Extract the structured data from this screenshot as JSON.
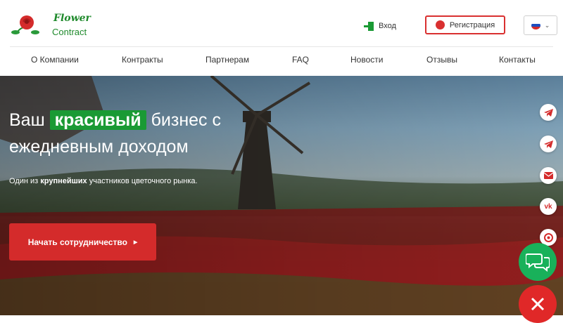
{
  "brand": {
    "line1": "Flower",
    "line2": "Contract"
  },
  "header": {
    "login_label": "Вход",
    "register_label": "Регистрация",
    "language": "RU"
  },
  "nav": {
    "items": [
      {
        "label": "О Компании"
      },
      {
        "label": "Контракты"
      },
      {
        "label": "Партнерам"
      },
      {
        "label": "FAQ"
      },
      {
        "label": "Новости"
      },
      {
        "label": "Отзывы"
      },
      {
        "label": "Контакты"
      }
    ]
  },
  "hero": {
    "title_part1": "Ваш",
    "title_highlight": "красивый",
    "title_part2": "бизнес с",
    "title_line2": "ежедневным доходом",
    "subtitle_prefix": "Один из",
    "subtitle_bold": "крупнейших",
    "subtitle_suffix": "участников цветочного рынка.",
    "cta_label": "Начать сотрудничество"
  },
  "social": [
    "telegram-icon",
    "telegram-icon",
    "mail-icon",
    "vk-icon",
    "support-icon"
  ],
  "colors": {
    "brand_green": "#1a9a34",
    "accent_red": "#d42b2b",
    "chat_green": "#19b15a"
  }
}
